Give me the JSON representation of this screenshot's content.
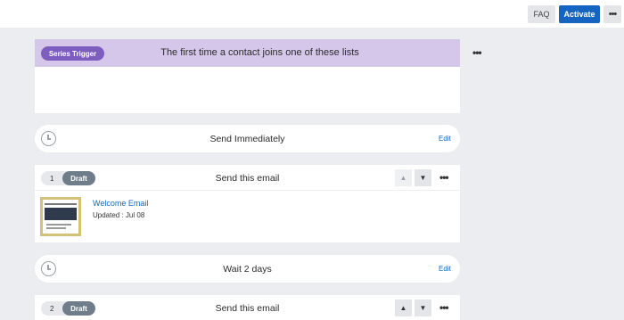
{
  "topbar": {
    "faq_label": "FAQ",
    "activate_label": "Activate",
    "more_label": "•••"
  },
  "colors": {
    "accent": "#1565c0",
    "trigger_header": "#d5c7ea",
    "trigger_pill": "#7d5ebf",
    "draft_pill": "#6f7d8a",
    "background": "#ebedf0"
  },
  "trigger": {
    "badge": "Series Trigger",
    "title": "The first time a contact joins one of these lists",
    "more_label": "•••"
  },
  "timings": [
    {
      "label": "Send Immediately",
      "edit_label": "Edit",
      "icon": "clock-icon"
    },
    {
      "label": "Wait 2 days",
      "edit_label": "Edit",
      "icon": "clock-icon"
    }
  ],
  "emails": [
    {
      "step": "1",
      "status": "Draft",
      "title": "Send this email",
      "name": "Welcome Email",
      "updated": "Updated : Jul 08",
      "more_label": "•••"
    },
    {
      "step": "2",
      "status": "Draft",
      "title": "Send this email",
      "more_label": "•••"
    }
  ],
  "icons": {
    "up": "▲",
    "down": "▼"
  }
}
